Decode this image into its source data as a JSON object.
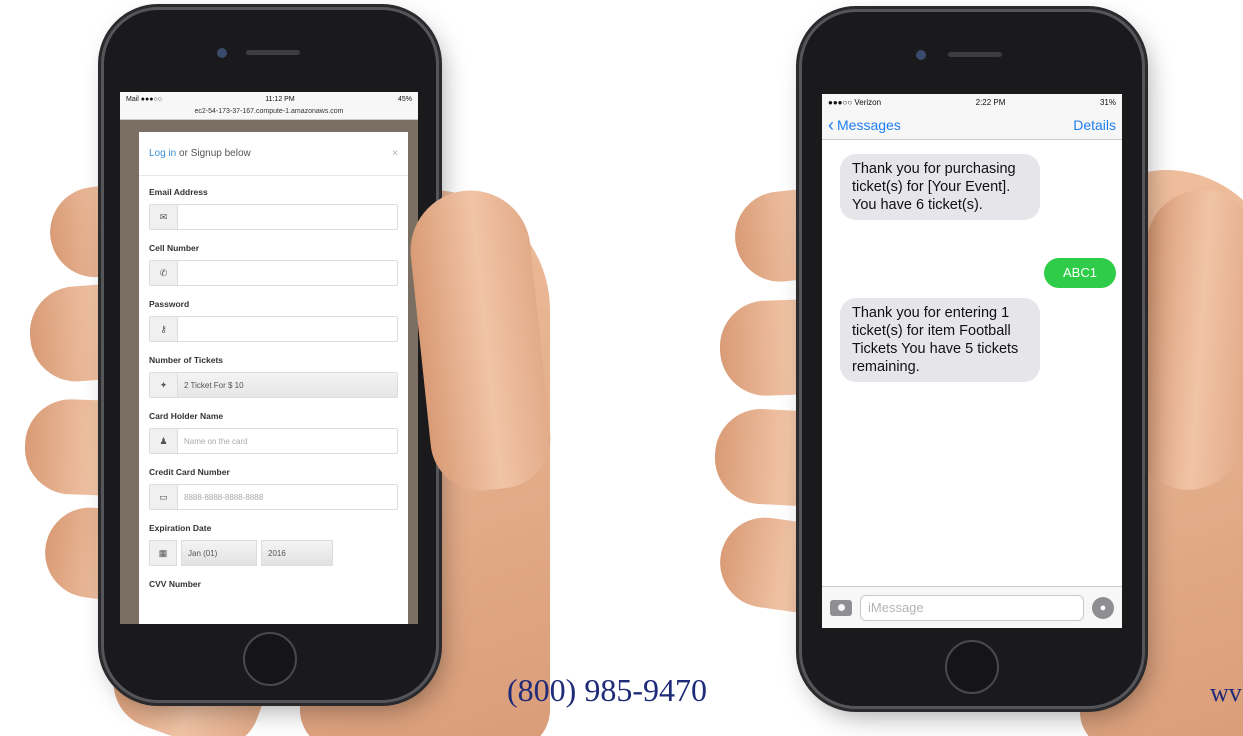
{
  "left_phone": {
    "status": {
      "carrier": "Mail ●●●○○",
      "wifi": "wifi-icon",
      "time": "11:12 PM",
      "battery": "45%"
    },
    "url": "ec2-54-173-37-167.compute-1.amazonaws.com",
    "header": {
      "login_link": "Log in",
      "rest": " or Signup below",
      "close": "×"
    },
    "form": {
      "email_label": "Email Address",
      "email_value": "",
      "cell_label": "Cell Number",
      "cell_value": "",
      "password_label": "Password",
      "password_value": "",
      "tickets_label": "Number of Tickets",
      "tickets_value": "2 Ticket For $ 10",
      "holder_label": "Card Holder Name",
      "holder_placeholder": "Name on the card",
      "card_label": "Credit Card Number",
      "card_placeholder": "8888-8888-8888-8888",
      "exp_label": "Expiration Date",
      "exp_month": "Jan (01)",
      "exp_year": "2016",
      "cvv_label": "CVV Number"
    }
  },
  "right_phone": {
    "status": {
      "carrier": "●●●○○ Verizon",
      "wifi": "wifi-icon",
      "time": "2:22 PM",
      "battery": "31%"
    },
    "nav": {
      "back": "Messages",
      "details": "Details"
    },
    "messages": [
      {
        "from": "them",
        "text": "Thank you for purchasing ticket(s) for [Your Event].  You have 6 ticket(s)."
      },
      {
        "from": "me",
        "text": "ABC1"
      },
      {
        "from": "them",
        "text": "Thank you for entering 1 ticket(s) for item Football Tickets  You have 5 tickets remaining."
      }
    ],
    "input_placeholder": "iMessage"
  },
  "footer": {
    "phone": "(800) 985-9470",
    "web_fragment": "wv"
  },
  "colors": {
    "ios_blue": "#1e7ef0",
    "imessage_green": "#2ecc48",
    "bubble_gray": "#e5e5ea",
    "footer_navy": "#1f2a78",
    "link_blue": "#3a8fd9"
  }
}
